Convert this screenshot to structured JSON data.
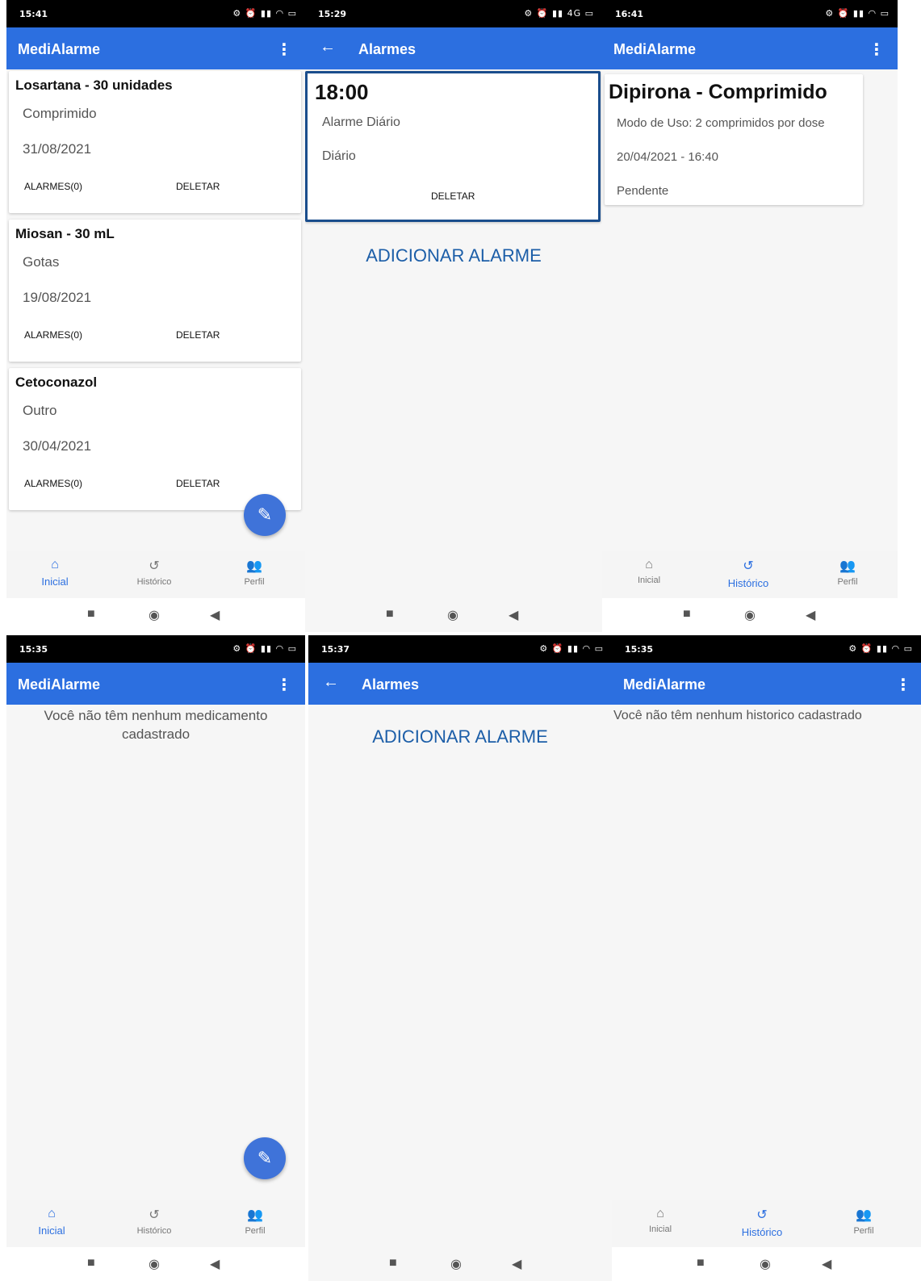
{
  "app": {
    "title": "MediAlarme",
    "alarms_title": "Alarmes",
    "menu_icon": "⋮",
    "back_icon": "←"
  },
  "nav": {
    "home": "Inicial",
    "history": "Histórico",
    "profile": "Perfil"
  },
  "screens": {
    "s1": {
      "time": "15:41",
      "meds": [
        {
          "name": "Losartana - 30 unidades",
          "form": "Comprimido",
          "date": "31/08/2021",
          "alarms": "ALARMES(0)",
          "delete": "DELETAR"
        },
        {
          "name": "Miosan - 30 mL",
          "form": "Gotas",
          "date": "19/08/2021",
          "alarms": "ALARMES(0)",
          "delete": "DELETAR"
        },
        {
          "name": "Cetoconazol",
          "form": "Outro",
          "date": "30/04/2021",
          "alarms": "ALARMES(0)",
          "delete": "DELETAR"
        }
      ]
    },
    "s2": {
      "time": "15:29",
      "alarm": {
        "time": "18:00",
        "name": "Alarme Diário",
        "frequency": "Diário",
        "delete": "DELETAR"
      },
      "add": "ADICIONAR ALARME"
    },
    "s3": {
      "time": "16:41",
      "history": {
        "title": "Dipirona - Comprimido",
        "usage": "Modo de Uso: 2 comprimidos por dose",
        "datetime": "20/04/2021 - 16:40",
        "status": "Pendente"
      }
    },
    "s4": {
      "time": "15:35",
      "empty": "Você não têm nenhum medicamento cadastrado"
    },
    "s5": {
      "time": "15:37",
      "add": "ADICIONAR ALARME"
    },
    "s6": {
      "time": "15:35",
      "empty": "Você não têm nenhum historico cadastrado"
    }
  },
  "colors": {
    "primary": "#2c6fe0",
    "fab": "#3f73d9",
    "add_link": "#1c5ea8"
  }
}
